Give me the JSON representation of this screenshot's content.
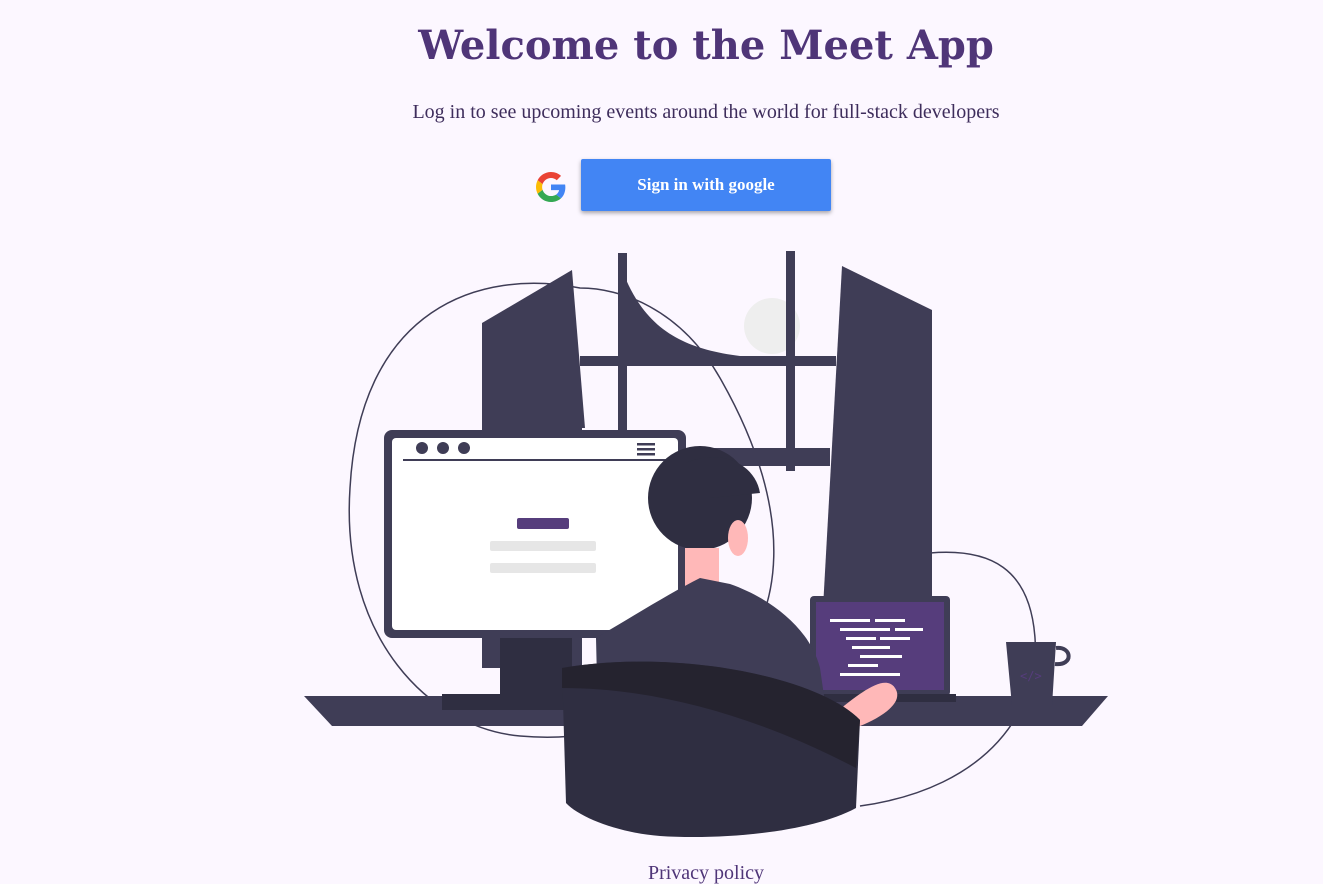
{
  "header": {
    "title": "Welcome to the Meet App",
    "subtitle": "Log in to see upcoming events around the world for full-stack developers"
  },
  "login": {
    "button_label": "Sign in with google",
    "button_color": "#4285f4",
    "icon": "google-g-icon"
  },
  "illustration": {
    "description_icon": "developer-at-desk-illustration",
    "accent_color": "#563d7c",
    "dark_color": "#3f3d56"
  },
  "footer": {
    "privacy_label": "Privacy policy"
  },
  "colors": {
    "background": "#fcf7ff",
    "title": "#4f3578"
  }
}
